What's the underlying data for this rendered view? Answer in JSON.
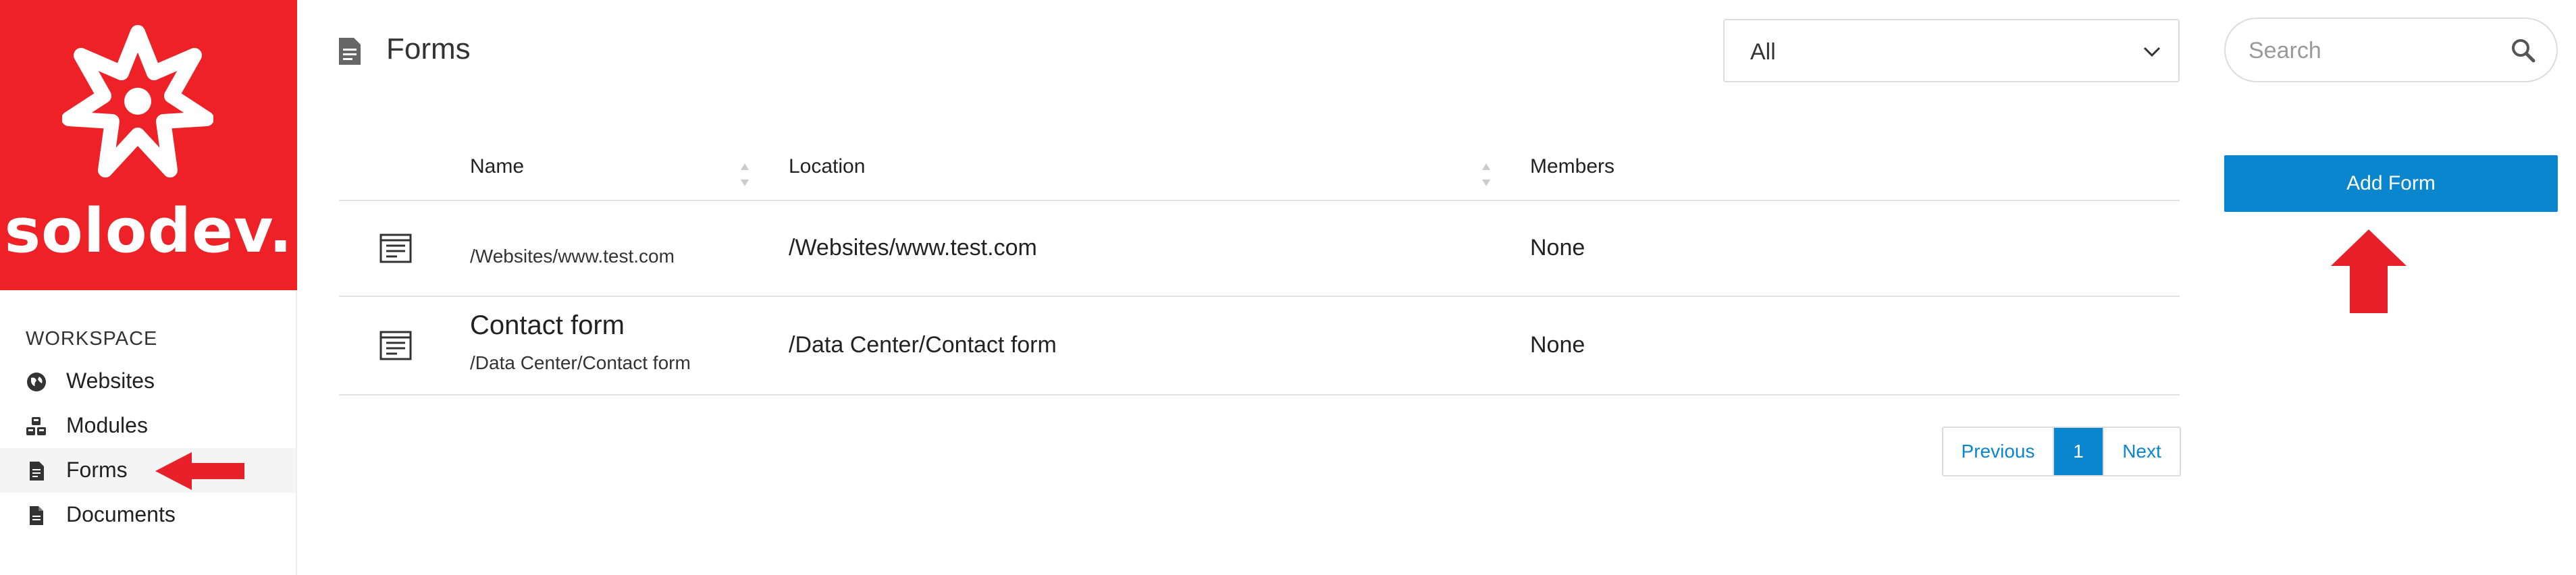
{
  "brand": {
    "logo_text": "solodev.",
    "logo_color": "#ee2126"
  },
  "sidebar": {
    "section_label": "WORKSPACE",
    "items": [
      {
        "label": "Websites",
        "icon": "globe-icon",
        "active": false
      },
      {
        "label": "Modules",
        "icon": "cubes-icon",
        "active": false
      },
      {
        "label": "Forms",
        "icon": "form-doc-icon",
        "active": true
      },
      {
        "label": "Documents",
        "icon": "document-icon",
        "active": false
      }
    ]
  },
  "header": {
    "title": "Forms",
    "filter_value": "All",
    "search_placeholder": "Search",
    "add_button_label": "Add Form"
  },
  "table": {
    "columns": [
      "Name",
      "Location",
      "Members"
    ],
    "rows": [
      {
        "name": "",
        "name_path": "/Websites/www.test.com",
        "location": "/Websites/www.test.com",
        "members": "None"
      },
      {
        "name": "Contact form",
        "name_path": "/Data Center/Contact form",
        "location": "/Data Center/Contact form",
        "members": "None"
      }
    ]
  },
  "pagination": {
    "previous": "Previous",
    "current": "1",
    "next": "Next"
  },
  "colors": {
    "accent": "#0a86cf",
    "annotation_arrow": "#e8202a"
  }
}
